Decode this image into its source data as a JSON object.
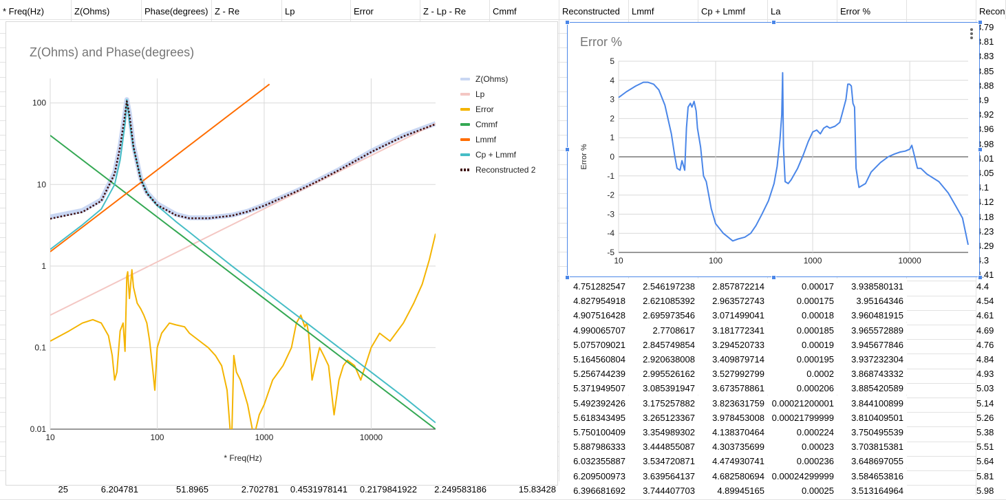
{
  "columns": [
    {
      "label": "* Freq(Hz)"
    },
    {
      "label": "Z(Ohms)"
    },
    {
      "label": "Phase(degrees)"
    },
    {
      "label": "Z - Re"
    },
    {
      "label": "Lp"
    },
    {
      "label": "Error"
    },
    {
      "label": "Z - Lp - Re"
    },
    {
      "label": "Cmmf"
    },
    {
      "label": "Reconstructed"
    },
    {
      "label": "Lmmf"
    },
    {
      "label": "Cp + Lmmf"
    },
    {
      "label": "La"
    },
    {
      "label": "Error %"
    },
    {
      "label": ""
    },
    {
      "label": "Recons"
    }
  ],
  "right_top_values": [
    "3.79",
    "3.81",
    "3.83",
    "3.85",
    "3.88",
    "3.9",
    "3.92",
    "3.96",
    "3.98",
    "4.01",
    "4.05",
    "4.1",
    "4.12",
    "4.18",
    "4.23",
    "4.29",
    "4.3",
    "4.41"
  ],
  "rows": [
    {
      "rec": "4.751282547",
      "lmmf": "2.546197238",
      "cpl": "2.857872214",
      "la": "0.00017",
      "err": "3.938580131",
      "r": "4.4"
    },
    {
      "rec": "4.827954918",
      "lmmf": "2.621085392",
      "cpl": "2.963572743",
      "la": "0.000175",
      "err": "3.95164346",
      "r": "4.54"
    },
    {
      "rec": "4.907516428",
      "lmmf": "2.695973546",
      "cpl": "3.071499041",
      "la": "0.00018",
      "err": "3.960481915",
      "r": "4.61"
    },
    {
      "rec": "4.990065707",
      "lmmf": "2.7708617",
      "cpl": "3.181772341",
      "la": "0.000185",
      "err": "3.965572889",
      "r": "4.69"
    },
    {
      "rec": "5.075709021",
      "lmmf": "2.845749854",
      "cpl": "3.294520733",
      "la": "0.00019",
      "err": "3.945677846",
      "r": "4.76"
    },
    {
      "rec": "5.164560804",
      "lmmf": "2.920638008",
      "cpl": "3.409879714",
      "la": "0.000195",
      "err": "3.937232304",
      "r": "4.84"
    },
    {
      "rec": "5.256744239",
      "lmmf": "2.995526162",
      "cpl": "3.527992799",
      "la": "0.0002",
      "err": "3.868743332",
      "r": "4.93"
    },
    {
      "rec": "5.371949507",
      "lmmf": "3.085391947",
      "cpl": "3.673578861",
      "la": "0.000206",
      "err": "3.885420589",
      "r": "5.03"
    },
    {
      "rec": "5.492392426",
      "lmmf": "3.175257882",
      "cpl": "3.823631759",
      "la": "0.00021200001",
      "err": "3.844100899",
      "r": "5.14"
    },
    {
      "rec": "5.618343495",
      "lmmf": "3.265123367",
      "cpl": "3.978453008",
      "la": "0.00021799999",
      "err": "3.810409501",
      "r": "5.26"
    },
    {
      "rec": "5.750100409",
      "lmmf": "3.354989302",
      "cpl": "4.138370464",
      "la": "0.000224",
      "err": "3.750495539",
      "r": "5.38"
    },
    {
      "rec": "5.887986333",
      "lmmf": "3.444855087",
      "cpl": "4.303735699",
      "la": "0.00023",
      "err": "3.703815381",
      "r": "5.51"
    },
    {
      "rec": "6.032355887",
      "lmmf": "3.534720871",
      "cpl": "4.474930741",
      "la": "0.000236",
      "err": "3.648697055",
      "r": "5.64"
    },
    {
      "rec": "6.209500973",
      "lmmf": "3.639564137",
      "cpl": "4.682580694",
      "la": "0.00024299999",
      "err": "3.584653816",
      "r": "5.81"
    },
    {
      "rec": "6.396681692",
      "lmmf": "3.744407703",
      "cpl": "4.89945165",
      "la": "0.00025",
      "err": "3.513164964",
      "r": "5.98"
    }
  ],
  "bottom_row": {
    "freq": "25",
    "z": "6.204781",
    "phase": "51.8965",
    "zre": "2.702781",
    "lp": "0.4531978141",
    "error": "0.2179841922",
    "zlpre": "2.249583186",
    "cmmf": "15.83428"
  },
  "chart_data": [
    {
      "type": "line",
      "title": "Z(Ohms) and Phase(degrees)",
      "xlabel": "* Freq(Hz)",
      "ylabel": "",
      "x_scale": "log",
      "y_scale": "log",
      "xlim": [
        10,
        40000
      ],
      "ylim": [
        0.01,
        200
      ],
      "x_ticks": [
        "10",
        "100",
        "1000",
        "10000"
      ],
      "y_ticks": [
        "0.01",
        "0.1",
        "1",
        "10",
        "100"
      ],
      "legend_position": "right",
      "grid": true,
      "series": [
        {
          "name": "Z(Ohms)",
          "color": "#c9d7f3",
          "x": [
            10,
            20,
            30,
            40,
            45,
            50,
            52,
            55,
            60,
            70,
            80,
            100,
            150,
            200,
            300,
            500,
            700,
            1000,
            2000,
            3000,
            5000,
            10000,
            20000,
            40000
          ],
          "y": [
            4,
            4.8,
            6.5,
            14,
            30,
            75,
            110,
            75,
            30,
            12,
            8,
            5.8,
            4.3,
            3.9,
            3.9,
            4.2,
            4.7,
            5.6,
            8.3,
            10.8,
            15.2,
            25.6,
            40,
            56
          ]
        },
        {
          "name": "Lp",
          "color": "#f4c7c3",
          "x": [
            10,
            40000
          ],
          "y": [
            0.25,
            56
          ]
        },
        {
          "name": "Error",
          "color": "#f4b400",
          "x": [
            10,
            15,
            20,
            25,
            30,
            35,
            38,
            40,
            42,
            45,
            48,
            50,
            52,
            53,
            55,
            58,
            60,
            65,
            70,
            75,
            80,
            85,
            90,
            95,
            100,
            110,
            130,
            150,
            180,
            200,
            250,
            300,
            350,
            400,
            450,
            480,
            500,
            520,
            550,
            600,
            700,
            800,
            900,
            1000,
            1200,
            1500,
            1800,
            2000,
            2200,
            2400,
            2500,
            2600,
            2700,
            2800,
            3000,
            3300,
            3600,
            4000,
            4500,
            5000,
            5500,
            6000,
            7000,
            8000,
            10000,
            12000,
            15000,
            20000,
            25000,
            30000,
            35000,
            40000
          ],
          "y": [
            0.12,
            0.16,
            0.2,
            0.22,
            0.2,
            0.14,
            0.08,
            0.04,
            0.05,
            0.16,
            0.2,
            0.09,
            0.75,
            0.85,
            0.4,
            0.9,
            0.55,
            0.35,
            0.3,
            0.25,
            0.2,
            0.12,
            0.06,
            0.03,
            0.1,
            0.15,
            0.2,
            0.19,
            0.18,
            0.15,
            0.12,
            0.1,
            0.08,
            0.06,
            0.03,
            0.01,
            0.01,
            0.08,
            0.05,
            0.04,
            0.02,
            0.008,
            0.015,
            0.02,
            0.04,
            0.06,
            0.1,
            0.2,
            0.25,
            0.18,
            0.2,
            0.15,
            0.08,
            0.04,
            0.06,
            0.1,
            0.08,
            0.06,
            0.015,
            0.04,
            0.06,
            0.07,
            0.06,
            0.04,
            0.1,
            0.15,
            0.12,
            0.2,
            0.35,
            0.6,
            1.2,
            2.5
          ]
        },
        {
          "name": "Cmmf",
          "color": "#34a853",
          "x": [
            10,
            40000
          ],
          "y": [
            40,
            0.01
          ]
        },
        {
          "name": "Lmmf",
          "color": "#ff6d01",
          "x": [
            10,
            1120
          ],
          "y": [
            1.5,
            170
          ]
        },
        {
          "name": "Cp + Lmmf",
          "color": "#46bdc6",
          "x": [
            10,
            20,
            30,
            40,
            45,
            50,
            52,
            55,
            60,
            70,
            80,
            100,
            150,
            200,
            300,
            500,
            1000,
            2000,
            5000,
            10000,
            20000,
            40000
          ],
          "y": [
            1.6,
            3.2,
            5,
            10,
            20,
            55,
            110,
            60,
            28,
            12,
            8,
            5.5,
            3.5,
            2.6,
            1.7,
            1.0,
            0.5,
            0.25,
            0.1,
            0.05,
            0.025,
            0.012
          ]
        },
        {
          "name": "Reconstructed 2",
          "color": "#3d0c0c",
          "x": [
            10,
            20,
            30,
            40,
            45,
            50,
            52,
            55,
            60,
            70,
            80,
            100,
            150,
            200,
            300,
            500,
            700,
            1000,
            2000,
            3000,
            5000,
            10000,
            20000,
            40000
          ],
          "y": [
            3.8,
            4.6,
            6.3,
            13.5,
            29,
            72,
            105,
            72,
            29,
            11.6,
            7.8,
            5.6,
            4.2,
            3.85,
            3.85,
            4.15,
            4.65,
            5.5,
            8.2,
            10.6,
            15,
            25,
            39,
            55
          ]
        }
      ]
    },
    {
      "type": "line",
      "title": "Error %",
      "xlabel": "",
      "ylabel": "Error %",
      "x_scale": "log",
      "xlim": [
        10,
        40000
      ],
      "ylim": [
        -5,
        5
      ],
      "x_ticks": [
        "10",
        "100",
        "1000",
        "10000"
      ],
      "y_ticks": [
        "-5",
        "-4",
        "-3",
        "-2",
        "-1",
        "0",
        "1",
        "2",
        "3",
        "4",
        "5"
      ],
      "grid": true,
      "series": [
        {
          "name": "Error %",
          "color": "#4a86e8",
          "x": [
            10,
            12,
            15,
            18,
            20,
            23,
            26,
            30,
            35,
            38,
            40,
            43,
            45,
            48,
            50,
            52,
            55,
            57,
            60,
            63,
            65,
            70,
            75,
            80,
            90,
            100,
            120,
            150,
            170,
            200,
            230,
            260,
            300,
            350,
            400,
            430,
            460,
            480,
            490,
            500,
            520,
            560,
            600,
            700,
            800,
            900,
            1000,
            1100,
            1200,
            1300,
            1400,
            1500,
            1700,
            1900,
            2000,
            2200,
            2300,
            2400,
            2500,
            2600,
            2700,
            2800,
            3000,
            3500,
            4000,
            5000,
            6000,
            7000,
            8000,
            9000,
            10000,
            10500,
            11000,
            12000,
            13000,
            15000,
            20000,
            25000,
            30000,
            35000,
            40000
          ],
          "y": [
            3.1,
            3.4,
            3.7,
            3.9,
            3.9,
            3.8,
            3.5,
            2.7,
            1.2,
            0,
            -0.6,
            -0.7,
            -0.2,
            -0.7,
            1.5,
            2.6,
            2.8,
            2.6,
            2.9,
            2.4,
            1.5,
            0.5,
            -1,
            -1.3,
            -2.7,
            -3.5,
            -4,
            -4.4,
            -4.3,
            -4.2,
            -4,
            -3.6,
            -3,
            -2.3,
            -1.4,
            -0.5,
            0.9,
            2.2,
            4.4,
            0.5,
            -1.3,
            -1.4,
            -1.2,
            -0.6,
            0.1,
            0.8,
            1.3,
            1.4,
            1.2,
            1.5,
            1.6,
            1.5,
            1.6,
            1.8,
            2.2,
            3,
            3.8,
            3.8,
            3.7,
            2.8,
            2.6,
            -0.6,
            -1.6,
            -1.4,
            -0.8,
            -0.3,
            0,
            0.15,
            0.25,
            0.3,
            0.4,
            0.6,
            0.2,
            -0.6,
            -0.6,
            -0.9,
            -1.3,
            -1.9,
            -2.6,
            -3.2,
            -4.6
          ]
        }
      ]
    }
  ]
}
